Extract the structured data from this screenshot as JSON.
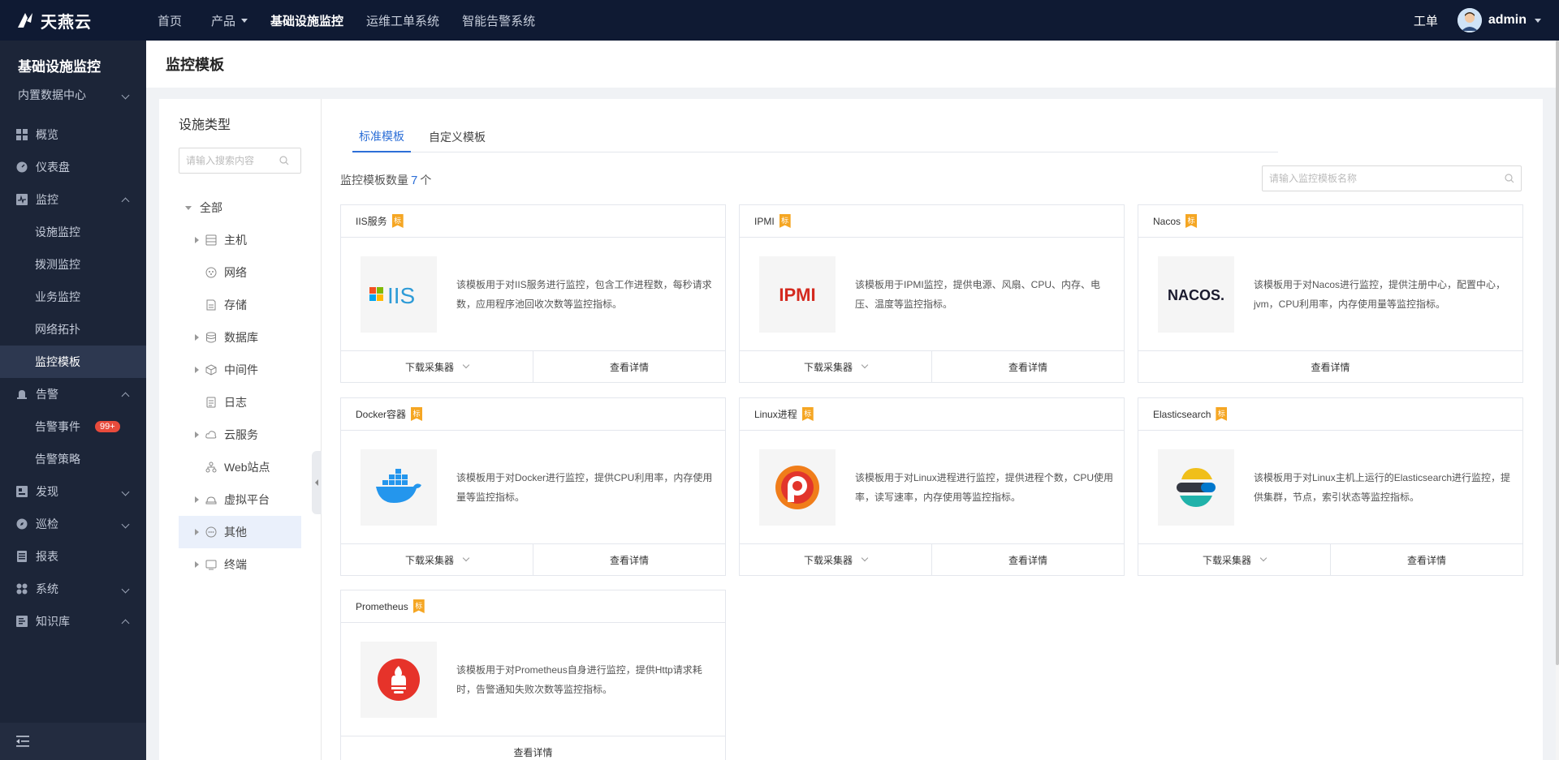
{
  "app": {
    "logo_text": "天燕云",
    "nav": [
      "首页",
      "产品",
      "基础设施监控",
      "运维工单系统",
      "智能告警系统"
    ],
    "ticket": "工单",
    "user": "admin"
  },
  "sidebar": {
    "title": "基础设施监控",
    "datacenter": "内置数据中心",
    "items": {
      "overview": "概览",
      "dashboard": "仪表盘",
      "monitor": "监控",
      "monitor_sub": [
        "设施监控",
        "拨测监控",
        "业务监控",
        "网络拓扑",
        "监控模板"
      ],
      "alarm": "告警",
      "alarm_event": "告警事件",
      "alarm_badge": "99+",
      "alarm_policy": "告警策略",
      "discover": "发现",
      "inspect": "巡检",
      "report": "报表",
      "system": "系统",
      "kb": "知识库"
    }
  },
  "page_title": "监控模板",
  "categories": {
    "title": "设施类型",
    "search_placeholder": "请输入搜索内容",
    "root": "全部",
    "items": [
      "主机",
      "网络",
      "存储",
      "数据库",
      "中间件",
      "日志",
      "云服务",
      "Web站点",
      "虚拟平台",
      "其他",
      "终端"
    ]
  },
  "main": {
    "tabs": [
      "标准模板",
      "自定义模板"
    ],
    "count_prefix": "监控模板数量",
    "count": "7",
    "count_suffix": "个",
    "search_placeholder": "请输入监控模板名称",
    "tag": "标",
    "download": "下载采集器",
    "details": "查看详情",
    "cards": [
      {
        "name": "IIS服务",
        "desc": "该模板用于对IIS服务进行监控，包含工作进程数，每秒请求数，应用程序池回收次数等监控指标。",
        "logo": "IIS"
      },
      {
        "name": "IPMI",
        "desc": "该模板用于IPMI监控，提供电源、风扇、CPU、内存、电压、温度等监控指标。",
        "logo": "IPMI"
      },
      {
        "name": "Nacos",
        "desc": "该模板用于对Nacos进行监控，提供注册中心，配置中心，jvm，CPU利用率，内存使用量等监控指标。",
        "logo": "NACOS."
      },
      {
        "name": "Docker容器",
        "desc": "该模板用于对Docker进行监控，提供CPU利用率，内存使用量等监控指标。",
        "logo": "docker"
      },
      {
        "name": "Linux进程",
        "desc": "该模板用于对Linux进程进行监控，提供进程个数，CPU使用率，读写速率，内存使用等监控指标。",
        "logo": "linux-process"
      },
      {
        "name": "Elasticsearch",
        "desc": "该模板用于对Linux主机上运行的Elasticsearch进行监控，提供集群，节点，索引状态等监控指标。",
        "logo": "elasticsearch"
      },
      {
        "name": "Prometheus",
        "desc": "该模板用于对Prometheus自身进行监控，提供Http请求耗时，告警通知失败次数等监控指标。",
        "logo": "prometheus"
      }
    ]
  },
  "colors": {
    "topbar": "#0f1a33",
    "sidebar": "#1c2538",
    "accent": "#2d6fd7",
    "tag": "#f5a623",
    "badge": "#e84b3c"
  }
}
